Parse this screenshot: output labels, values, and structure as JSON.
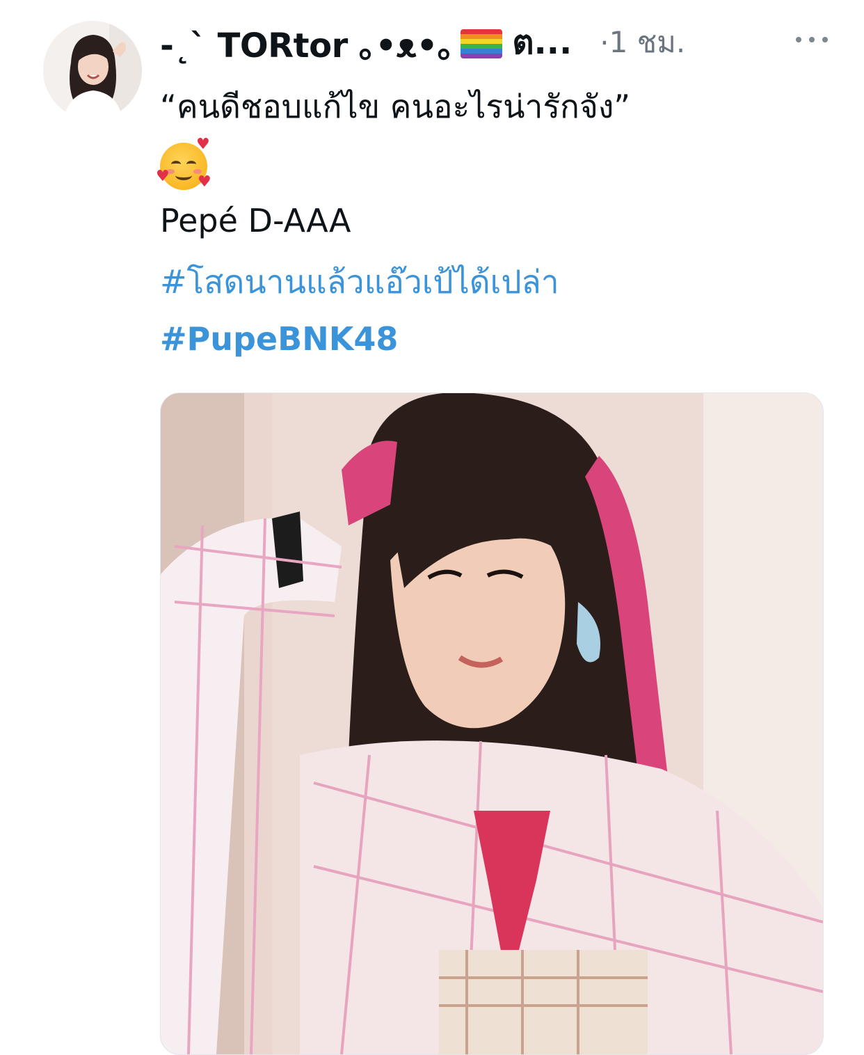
{
  "tweet": {
    "author": {
      "display_name_lead": "-˛` TORtor ｡•ᴥ•｡",
      "display_name_tail": "ต...",
      "avatar_icon": "profile-photo"
    },
    "meta": {
      "separator": "·",
      "timestamp": "1 ชม."
    },
    "more_icon": "ellipsis-icon",
    "text": {
      "quote": "“คนดีชอบแก้ไข คนอะไรน่ารักจัง”",
      "emoji": "smiling-face-with-hearts",
      "name": "Pepé D-AAA",
      "hashtags": [
        "#โสดนานแล้วแอ๊วเป้ได้เปล่า",
        "#PupeBNK48"
      ]
    },
    "media": {
      "type": "photo"
    },
    "colors": {
      "link": "#3b94d9",
      "secondary_text": "#6b7580",
      "primary_text": "#0f1419"
    }
  }
}
